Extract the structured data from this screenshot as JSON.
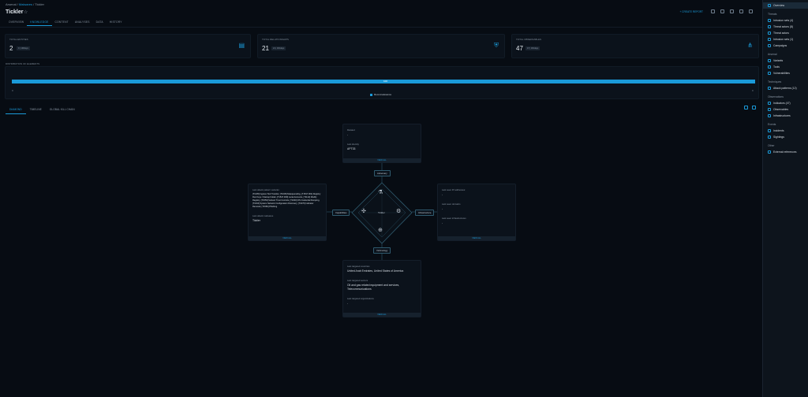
{
  "breadcrumb": {
    "root": "Arsenal",
    "mid": "Malwares",
    "current": "Tickler"
  },
  "title": "Tickler",
  "tabs": [
    "OVERVIEW",
    "KNOWLEDGE",
    "CONTENT",
    "ANALYSES",
    "DATA",
    "HISTORY"
  ],
  "top_action": "+ CREATE REPORT",
  "cards": [
    {
      "label": "TOTAL ENTITIES",
      "value": "2",
      "delta": "0 | 1M/days",
      "icon": "document-icon"
    },
    {
      "label": "TOTAL RELATIONSHIPS",
      "value": "21",
      "delta": "21 | 1M/days",
      "icon": "shield-icon"
    },
    {
      "label": "TOTAL OBSERVABLES",
      "value": "47",
      "delta": "47 | 1M/days",
      "icon": "hub-icon"
    }
  ],
  "distribution": {
    "label": "DISTRIBUTION OF ELEMENTS",
    "bar_value": "100",
    "fraction": 1.0,
    "axis_left": "0",
    "axis_right": "0",
    "legend": "Reconnaissance"
  },
  "subtabs": [
    "DIAMOND",
    "TIMELINE",
    "GLOBAL KILL CHAIN"
  ],
  "diamond": {
    "center": "Tickler",
    "top_card": {
      "k1": "Related",
      "v1": "-",
      "k2": "Last identity",
      "v2": "APT33",
      "foot": "VIEW ALL"
    },
    "left_card": {
      "k1": "Last attack pattern variants:",
      "v1": "[T1105] Ingress Tool Transfer, [T1036] Masquerading, [T1547.001] Registry Run Keys / Startup Folder, [T1547.009] Local Accounts, [T1112] Modify Registry, [T1553] Subvert Trust Controls, [T1003] OS Credential Dumping, [T1016] System Network Configuration Discovery, [T1070] Indicator Removal, [T1566] Phishing",
      "k2": "Last attack malwares",
      "v2": "Tickler",
      "foot": "VIEW ALL"
    },
    "right_card": {
      "k1": "Last seen IP addresses:",
      "v1": "-",
      "k2": "Last seen domains",
      "v2": "-",
      "k3": "Last seen infrastructures",
      "v3": "-",
      "foot": "VIEW ALL"
    },
    "bottom_card": {
      "k1": "Last targeted countries",
      "v1": "United Arab Emirates, United States of America",
      "k2": "Last targeted sectors",
      "v2": "Oil and gas related equipment and services, Telecommunications",
      "k3": "Last targeted organizations",
      "v3": "-",
      "foot": "VIEW ALL"
    },
    "labels": {
      "top": "Adversary",
      "left": "Capabilities",
      "right": "Infrastructure",
      "bottom": "Victimology"
    }
  },
  "sidebar": {
    "top": "Overview",
    "sections": [
      {
        "title": "Threats",
        "items": [
          "Intrusion sets (4)",
          "Threat actors (8)",
          "Threat actors",
          "Intrusion sets (1)",
          "Campaigns"
        ]
      },
      {
        "title": "Arsenal",
        "items": [
          "Variants",
          "Tools",
          "Vulnerabilities"
        ]
      },
      {
        "title": "Techniques",
        "items": [
          "Attack patterns (12)"
        ]
      },
      {
        "title": "Observations",
        "items": [
          "Indicators (47)",
          "Observables",
          "Infrastructures"
        ]
      },
      {
        "title": "Events",
        "items": [
          "Incidents",
          "Sightings"
        ]
      },
      {
        "title": "Other",
        "items": [
          "External references"
        ]
      }
    ]
  }
}
